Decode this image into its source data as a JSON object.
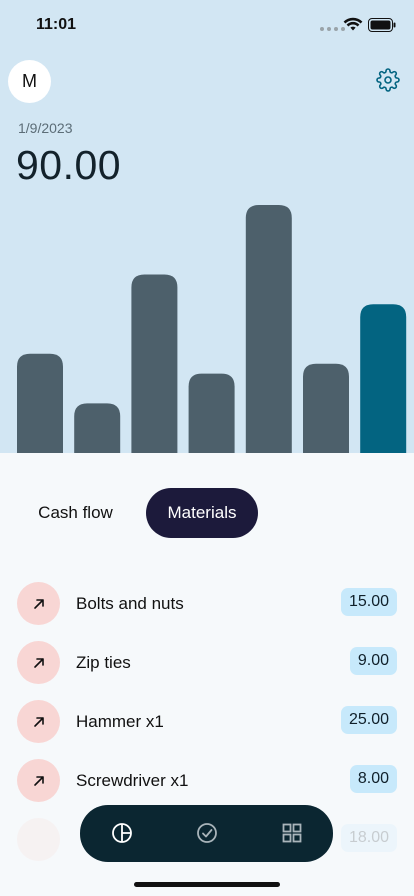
{
  "status_bar": {
    "time": "11:01"
  },
  "header": {
    "avatar_initial": "M",
    "date": "1/9/2023",
    "amount": "90.00"
  },
  "chart_data": {
    "type": "bar",
    "values": [
      50,
      25,
      90,
      40,
      125,
      45,
      75
    ],
    "highlighted_index": 6,
    "colors": {
      "default": "#4d606b",
      "highlight": "#036481"
    }
  },
  "tabs": [
    {
      "label": "Cash flow",
      "active": false
    },
    {
      "label": "Materials",
      "active": true
    }
  ],
  "items": [
    {
      "name": "Bolts and nuts",
      "price": "15.00"
    },
    {
      "name": "Zip ties",
      "price": "9.00"
    },
    {
      "name": "Hammer x1",
      "price": "25.00"
    },
    {
      "name": "Screwdriver x1",
      "price": "8.00"
    },
    {
      "name": "",
      "price": "18.00"
    }
  ],
  "nav": {
    "items": [
      "chart-pie-icon",
      "check-circle-icon",
      "grid-icon"
    ],
    "active_index": 0
  },
  "colors": {
    "header_bg": "#d2e6f3",
    "accent": "#036481",
    "nav_bg": "#0b2631",
    "tab_active_bg": "#1c1a3b"
  }
}
